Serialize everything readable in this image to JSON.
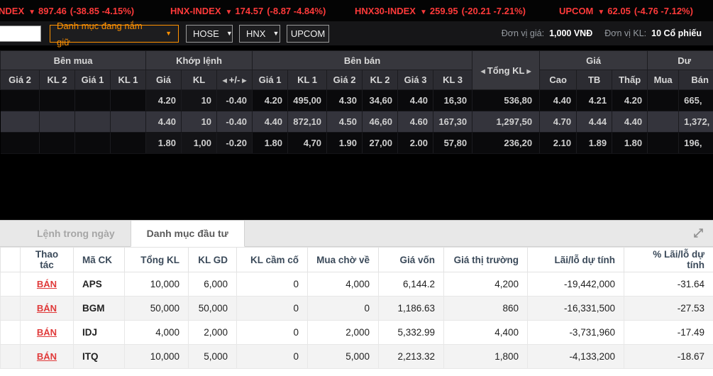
{
  "icons": {
    "down_arrow": "▼",
    "caret_down": "▼",
    "scroll_left": "◀",
    "scroll_right": "▶"
  },
  "colors": {
    "down_red": "#ff3a3a",
    "floor_teal": "#2bc1ce",
    "reference_yellow": "#c9b40a",
    "up_green": "#21cd2e",
    "accent_orange": "#ff9100",
    "market_cyan": "#00b2cc",
    "market_green": "#3aaf4c",
    "loss_red": "#e84545"
  },
  "tickers": [
    {
      "name": "VN-INDEX",
      "value": "897.46",
      "change": "(-38.85 -4.15%)"
    },
    {
      "name": "HNX-INDEX",
      "value": "174.57",
      "change": "(-8.87 -4.84%)"
    },
    {
      "name": "HNX30-INDEX",
      "value": "259.95",
      "change": "(-20.21 -7.21%)"
    },
    {
      "name": "UPCOM",
      "value": "62.05",
      "change": "(-4.76 -7.12%)"
    }
  ],
  "toolbar": {
    "search_value": "",
    "watchlist_dropdown": "Danh mục đang nắm giữ",
    "hose_dropdown": "HOSE",
    "hnx_dropdown": "HNX",
    "upcom_button": "UPCOM",
    "unit_price_label": "Đơn vị giá:",
    "unit_price_value": "1,000 VNĐ",
    "unit_volume_label": "Đơn vị KL:",
    "unit_volume_value": "10 Cổ phiếu"
  },
  "board": {
    "group_headers": {
      "buy": "Bên mua",
      "matched": "Khớp lệnh",
      "sell": "Bên bán",
      "total": "Tổng KL",
      "price": "Giá",
      "remain": "Dư"
    },
    "sub_headers": [
      "Giá 2",
      "KL 2",
      "Giá 1",
      "KL 1",
      "Giá",
      "KL",
      "+/-",
      "Giá 1",
      "KL 1",
      "Giá 2",
      "KL 2",
      "Giá 3",
      "KL 3",
      "Cao",
      "TB",
      "Thấp",
      "Mua",
      "Bán"
    ],
    "selected_row": 1,
    "rows": [
      [
        [
          "",
          ""
        ],
        [
          "",
          ""
        ],
        [
          "",
          ""
        ],
        [
          "",
          ""
        ],
        [
          "4.20",
          "teal"
        ],
        [
          "10",
          "teal"
        ],
        [
          "-0.40",
          "red"
        ],
        [
          "4.20",
          "teal"
        ],
        [
          "495,00",
          "teal"
        ],
        [
          "4.30",
          "red"
        ],
        [
          "34,60",
          "red"
        ],
        [
          "4.40",
          "red"
        ],
        [
          "16,30",
          "red"
        ],
        [
          "536,80",
          "white"
        ],
        [
          "4.40",
          "red"
        ],
        [
          "4.21",
          "red"
        ],
        [
          "4.20",
          "teal"
        ],
        [
          "",
          ""
        ],
        [
          "665,",
          "white"
        ]
      ],
      [
        [
          "",
          ""
        ],
        [
          "",
          ""
        ],
        [
          "",
          ""
        ],
        [
          "",
          ""
        ],
        [
          "4.40",
          "teal"
        ],
        [
          "10",
          "teal"
        ],
        [
          "-0.40",
          "red"
        ],
        [
          "4.40",
          "teal"
        ],
        [
          "872,10",
          "teal"
        ],
        [
          "4.50",
          "red"
        ],
        [
          "46,60",
          "red"
        ],
        [
          "4.60",
          "red"
        ],
        [
          "167,30",
          "red"
        ],
        [
          "1,297,50",
          "white"
        ],
        [
          "4.70",
          "red"
        ],
        [
          "4.44",
          "red"
        ],
        [
          "4.40",
          "teal"
        ],
        [
          "",
          ""
        ],
        [
          "1,372,",
          "white"
        ]
      ],
      [
        [
          "",
          ""
        ],
        [
          "",
          ""
        ],
        [
          "",
          ""
        ],
        [
          "",
          ""
        ],
        [
          "1.80",
          "teal"
        ],
        [
          "1,00",
          "teal"
        ],
        [
          "-0.20",
          "red"
        ],
        [
          "1.80",
          "teal"
        ],
        [
          "4,70",
          "teal"
        ],
        [
          "1.90",
          "red"
        ],
        [
          "27,00",
          "red"
        ],
        [
          "2.00",
          "yellow"
        ],
        [
          "57,80",
          "yellow"
        ],
        [
          "236,20",
          "white"
        ],
        [
          "2.10",
          "green"
        ],
        [
          "1.89",
          "red"
        ],
        [
          "1.80",
          "teal"
        ],
        [
          "",
          ""
        ],
        [
          "196,",
          "white"
        ]
      ]
    ]
  },
  "portfolio": {
    "tabs": [
      {
        "label": "Lệnh trong ngày",
        "active": false
      },
      {
        "label": "Danh mục đầu tư",
        "active": true
      }
    ],
    "headers": [
      "Thao tác",
      "Mã CK",
      "Tổng KL",
      "KL GD",
      "KL cầm cố",
      "Mua chờ về",
      "Giá vốn",
      "Giá thị trường",
      "Lãi/lỗ dự tính",
      "% Lãi/lỗ dự tính"
    ],
    "rows": [
      {
        "action": "BÁN",
        "symbol": "APS",
        "tong_kl": "10,000",
        "kl_gd": "6,000",
        "kl_cam_co": "0",
        "mua_cho_ve": "4,000",
        "gia_von": "6,144.2",
        "gia_thi_truong": "4,200",
        "gia_thi_truong_color": "cyan",
        "lai_lo": "-19,442,000",
        "pct_lai_lo": "-31.64"
      },
      {
        "action": "BÁN",
        "symbol": "BGM",
        "tong_kl": "50,000",
        "kl_gd": "50,000",
        "kl_cam_co": "0",
        "mua_cho_ve": "0",
        "gia_von": "1,186.63",
        "gia_thi_truong": "860",
        "gia_thi_truong_color": "dark",
        "lai_lo": "-16,331,500",
        "pct_lai_lo": "-27.53"
      },
      {
        "action": "BÁN",
        "symbol": "IDJ",
        "tong_kl": "4,000",
        "kl_gd": "2,000",
        "kl_cam_co": "0",
        "mua_cho_ve": "2,000",
        "gia_von": "5,332.99",
        "gia_thi_truong": "4,400",
        "gia_thi_truong_color": "cyan",
        "lai_lo": "-3,731,960",
        "pct_lai_lo": "-17.49"
      },
      {
        "action": "BÁN",
        "symbol": "ITQ",
        "tong_kl": "10,000",
        "kl_gd": "5,000",
        "kl_cam_co": "0",
        "mua_cho_ve": "5,000",
        "gia_von": "2,213.32",
        "gia_thi_truong": "1,800",
        "gia_thi_truong_color": "green",
        "lai_lo": "-4,133,200",
        "pct_lai_lo": "-18.67"
      }
    ]
  }
}
